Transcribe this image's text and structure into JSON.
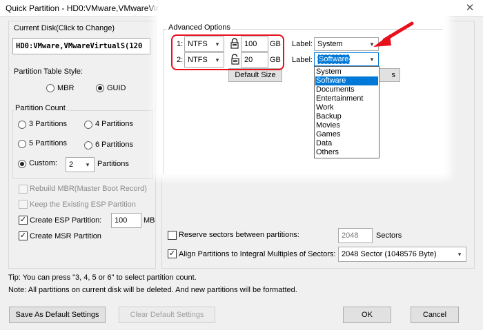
{
  "window": {
    "title": "Quick Partition - HD0:VMware,VMwareVirtualS(120GB)",
    "close_glyph": "✕"
  },
  "current_disk": {
    "label": "Current Disk(Click to Change)",
    "value": "HD0:VMware,VMwareVirtualS(120"
  },
  "partition_table": {
    "label": "Partition Table Style:",
    "options": [
      "MBR",
      "GUID"
    ],
    "selected": "GUID"
  },
  "partition_count": {
    "label": "Partition Count",
    "options": [
      "3 Partitions",
      "4 Partitions",
      "5 Partitions",
      "6 Partitions"
    ],
    "custom_label": "Custom:",
    "custom_value": "2",
    "custom_suffix": "Partitions"
  },
  "options": {
    "rebuild_mbr": "Rebuild MBR(Master Boot Record)",
    "keep_esp": "Keep the Existing ESP Partition",
    "create_esp": "Create ESP Partition:",
    "esp_size": "100",
    "esp_unit": "MB",
    "create_msr": "Create MSR Partition"
  },
  "advanced": {
    "title": "Advanced Options",
    "partitions": [
      {
        "index": "1:",
        "fs": "NTFS",
        "size": "100",
        "unit": "GB",
        "label_caption": "Label:",
        "label": "System",
        "icon": "lock-icon"
      },
      {
        "index": "2:",
        "fs": "NTFS",
        "size": "20",
        "unit": "GB",
        "label_caption": "Label:",
        "label": "Software",
        "icon": "unlock-icon"
      }
    ],
    "default_size_button": "Default Size",
    "hidden_button_tail": "s",
    "label_options": [
      "System",
      "Software",
      "Documents",
      "Entertainment",
      "Work",
      "Backup",
      "Movies",
      "Games",
      "Data",
      "Others"
    ],
    "label_selected": "Software"
  },
  "sectors": {
    "reserve_label": "Reserve sectors between partitions:",
    "reserve_value": "2048",
    "reserve_unit": "Sectors",
    "align_label": "Align Partitions to Integral Multiples of Sectors:",
    "align_value": "2048 Sector (1048576 Byte)"
  },
  "tips": {
    "tip": "Tip:  You can press \"3, 4, 5 or 6\" to select partition count.",
    "note": "Note: All partitions on current disk will be deleted. And new partitions will be formatted."
  },
  "buttons": {
    "save_default": "Save As Default Settings",
    "clear_default": "Clear Default Settings",
    "ok": "OK",
    "cancel": "Cancel"
  },
  "colors": {
    "highlight": "#e8101c",
    "selection": "#0078d7",
    "arrow": "#e8101c"
  }
}
